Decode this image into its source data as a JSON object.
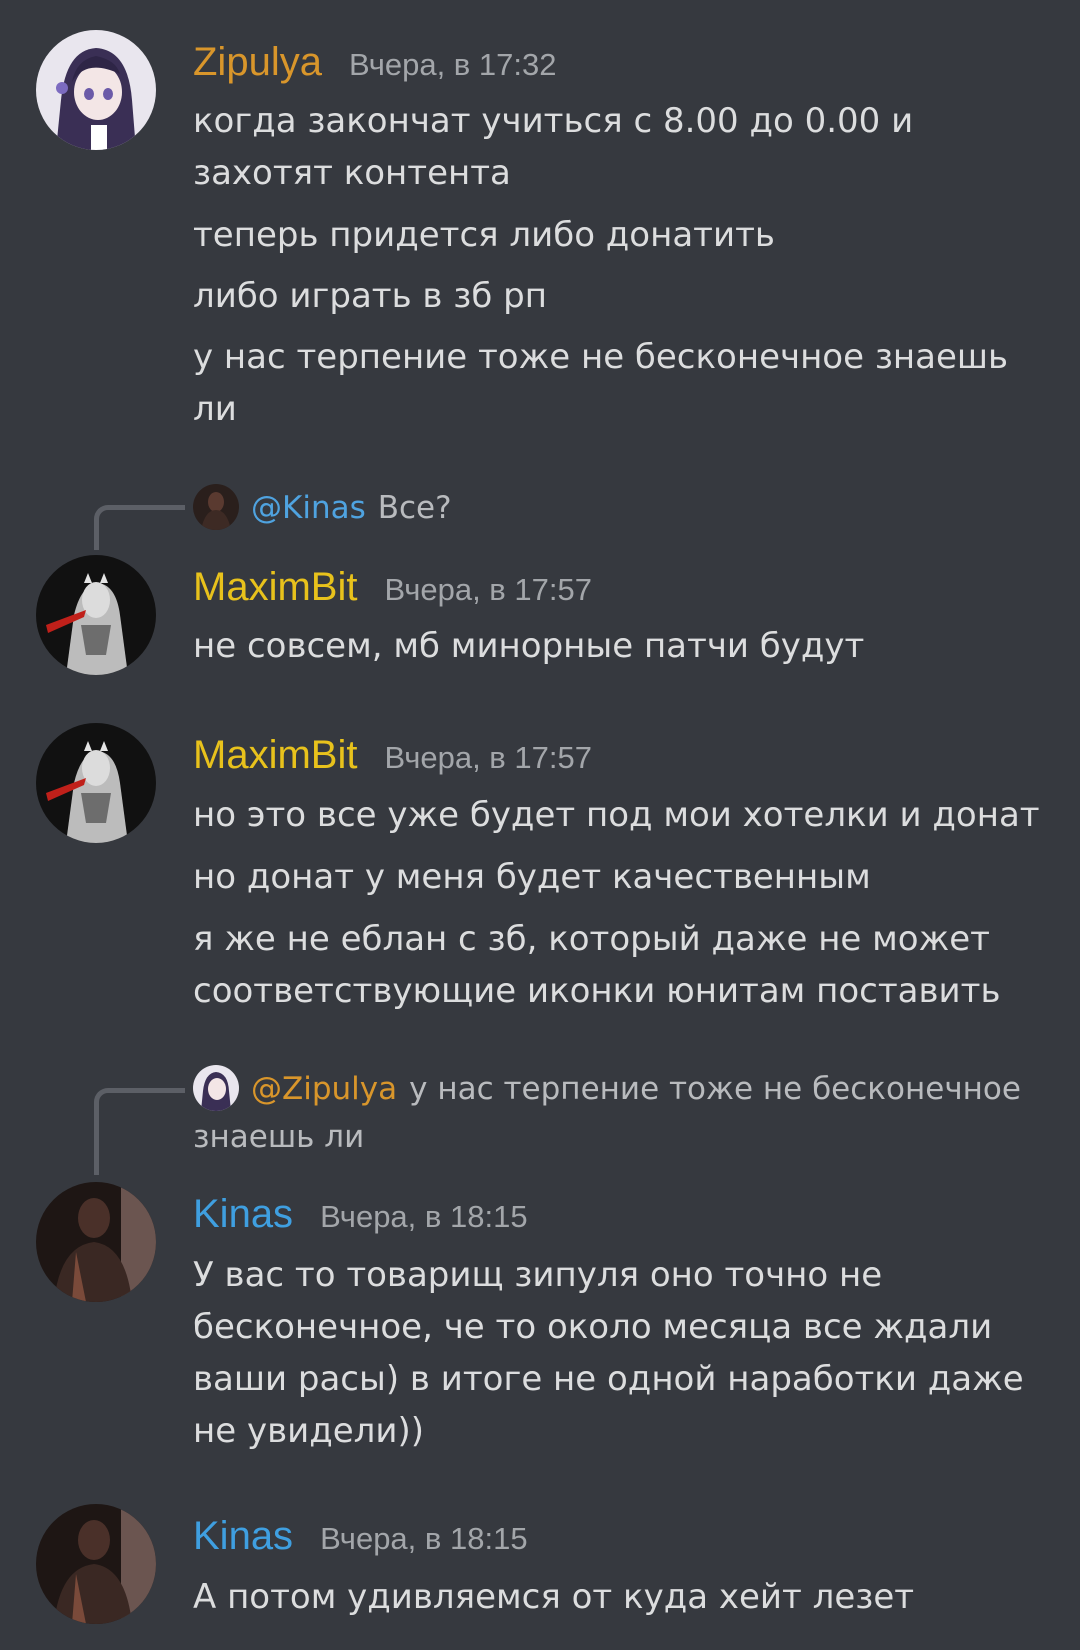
{
  "colors": {
    "background": "#36393f",
    "zipulya": "#d9962b",
    "maximbit": "#e8c21c",
    "kinas": "#3f9fe0",
    "mention": "#4fa3e0",
    "text": "#dcddde",
    "muted": "#a3a6aa"
  },
  "messages": [
    {
      "author": "Zipulya",
      "time": "Вчера, в 17:32",
      "lines": [
        "когда закончат учиться с 8.00 до 0.00 и",
        "захотят контента",
        "теперь придется либо донатить",
        "либо играть в зб рп",
        "у нас терпение тоже не бесконечное знаешь",
        "ли"
      ]
    },
    {
      "reply": {
        "mention": "@Kinas",
        "text": "Все?"
      },
      "author": "MaximBit",
      "time": "Вчера, в 17:57",
      "lines": [
        "не совсем, мб минорные патчи будут"
      ]
    },
    {
      "author": "MaximBit",
      "time": "Вчера, в 17:57",
      "lines": [
        "но это все уже будет под мои хотелки и донат",
        "но донат у меня будет качественным",
        "я же не еблан с зб, который даже не может",
        "соответствующие иконки юнитам поставить"
      ]
    },
    {
      "reply": {
        "mention": "@Zipulya",
        "text": "у нас терпение тоже не бесконечное",
        "text2": "знаешь ли"
      },
      "author": "Kinas",
      "time": "Вчера, в 18:15",
      "lines": [
        "У вас то товарищ зипуля оно точно не",
        "бесконечное, че то около месяца все ждали",
        "ваши расы) в итоге не одной наработки даже",
        "не увидели))"
      ]
    },
    {
      "author": "Kinas",
      "time": "Вчера, в 18:15",
      "lines": [
        "А потом удивляемся от куда хейт лезет"
      ]
    }
  ]
}
